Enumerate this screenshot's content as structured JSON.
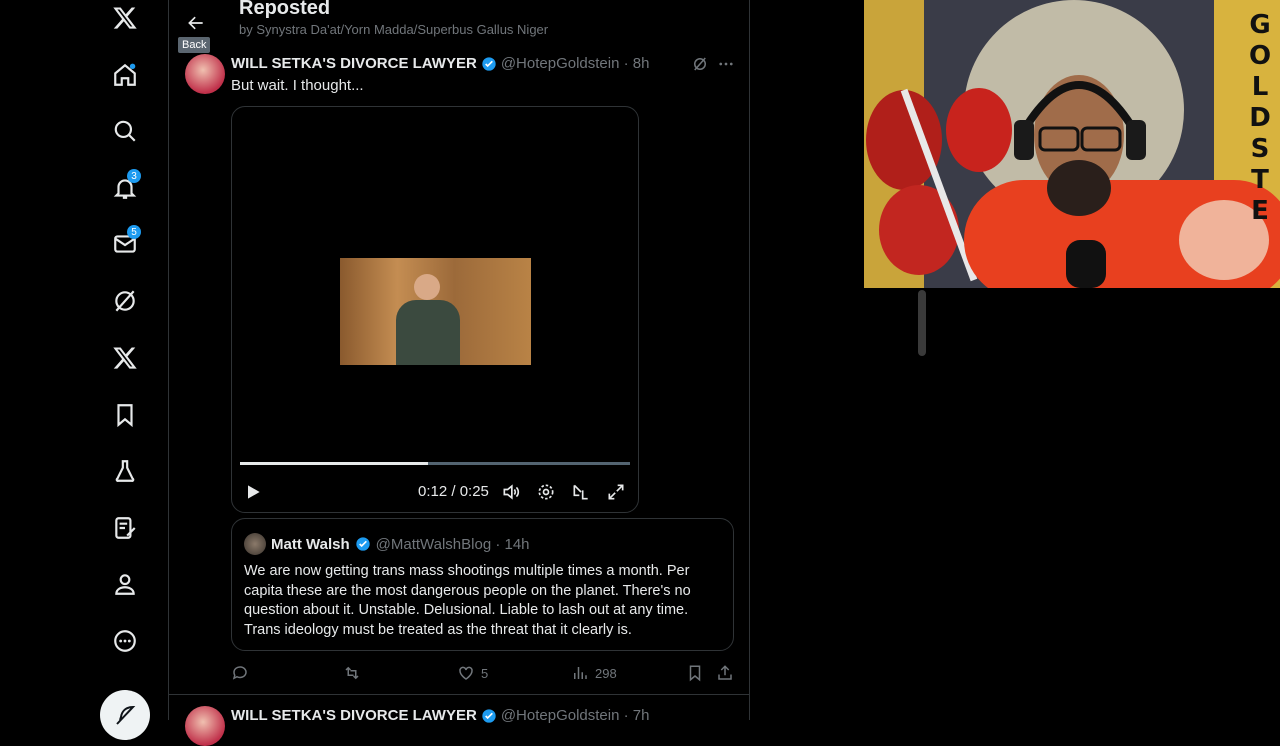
{
  "sidebar": {
    "notifications_badge": "3",
    "messages_badge": "5"
  },
  "header": {
    "title": "Reposted",
    "subtitle": "by Synystra Da'at/Yorn Madda/Superbus Gallus Niger",
    "back_tooltip": "Back"
  },
  "tweet": {
    "name": "WILL SETKA'S DIVORCE LAWYER",
    "handle": "@HotepGoldstein · 8h",
    "text": "But wait. I thought...",
    "video": {
      "time": "0:12 / 0:25",
      "progress": 0.483
    },
    "quote": {
      "name": "Matt Walsh",
      "handle": "@MattWalshBlog · 14h",
      "text": "We are now getting trans mass shootings multiple times a month. Per capita these are the most dangerous people on the planet. There's no question about it. Unstable. Delusional. Liable to lash out at any time. Trans ideology must be treated as the threat that it clearly is."
    },
    "actions": {
      "likes": "5",
      "views": "298"
    }
  },
  "next_tweet": {
    "name": "WILL SETKA'S DIVORCE LAWYER",
    "handle": "@HotepGoldstein · 7h"
  },
  "webcam": {
    "banner_letters": "GOLDSTE"
  }
}
